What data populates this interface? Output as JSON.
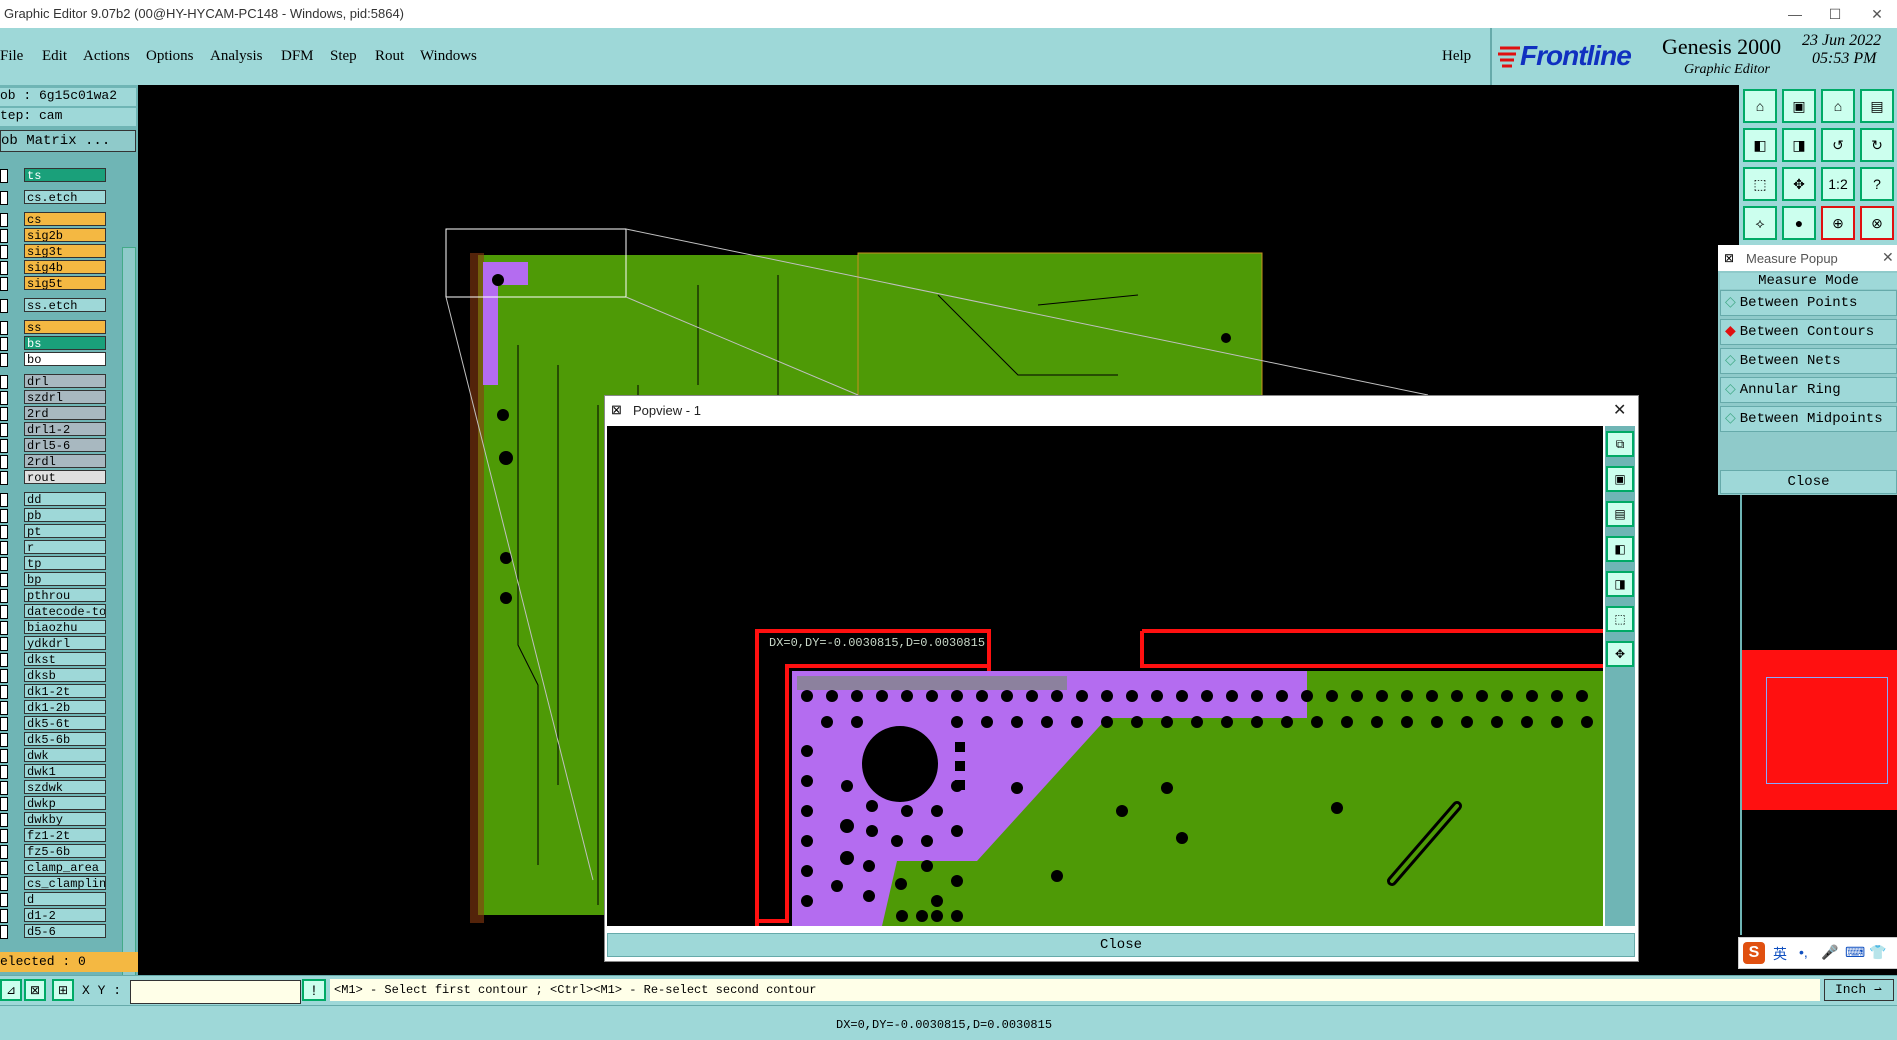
{
  "window": {
    "title": "Graphic Editor 9.07b2 (00@HY-HYCAM-PC148 - Windows, pid:5864)",
    "minimize": "—",
    "maximize": "☐",
    "close": "✕"
  },
  "menu": {
    "items": [
      "File",
      "Edit",
      "Actions",
      "Options",
      "Analysis",
      "DFM",
      "Step",
      "Rout",
      "Windows"
    ],
    "help": "Help"
  },
  "brand": {
    "logo": "Frontline",
    "product": "Genesis 2000",
    "subtitle": "Graphic Editor",
    "date": "23 Jun 2022",
    "time": "05:53 PM"
  },
  "job": {
    "job_line": "ob : 6g15c01wa2",
    "step_line": "tep: cam",
    "matrix_button": "ob Matrix ..."
  },
  "layers": [
    {
      "name": "ts",
      "color": "#1aa07a",
      "text": "#fff"
    },
    {
      "name": "cs.etch",
      "color": "#9ed8d8",
      "text": "#000"
    },
    {
      "name": "cs",
      "color": "#f4b842",
      "text": "#000"
    },
    {
      "name": "sig2b",
      "color": "#f4b842",
      "text": "#000"
    },
    {
      "name": "sig3t",
      "color": "#f4b842",
      "text": "#000"
    },
    {
      "name": "sig4b",
      "color": "#f4b842",
      "text": "#000"
    },
    {
      "name": "sig5t",
      "color": "#f4b842",
      "text": "#000"
    },
    {
      "name": "ss.etch",
      "color": "#9ed8d8",
      "text": "#000"
    },
    {
      "name": "ss",
      "color": "#f4b842",
      "text": "#000"
    },
    {
      "name": "bs",
      "color": "#1aa07a",
      "text": "#fff"
    },
    {
      "name": "bo",
      "color": "#ffffff",
      "text": "#000"
    },
    {
      "name": "drl",
      "color": "#a8b8c0",
      "text": "#000"
    },
    {
      "name": "szdrl",
      "color": "#a8b8c0",
      "text": "#000"
    },
    {
      "name": "2rd",
      "color": "#a8b8c0",
      "text": "#000"
    },
    {
      "name": "drl1-2",
      "color": "#a8b8c0",
      "text": "#000"
    },
    {
      "name": "drl5-6",
      "color": "#a8b8c0",
      "text": "#000"
    },
    {
      "name": "2rdl",
      "color": "#a8b8c0",
      "text": "#000"
    },
    {
      "name": "rout",
      "color": "#e0e0e0",
      "text": "#000"
    },
    {
      "name": "dd",
      "color": "#9ed8d8",
      "text": "#000"
    },
    {
      "name": "pb",
      "color": "#9ed8d8",
      "text": "#000"
    },
    {
      "name": "pt",
      "color": "#9ed8d8",
      "text": "#000"
    },
    {
      "name": "r",
      "color": "#9ed8d8",
      "text": "#000"
    },
    {
      "name": "tp",
      "color": "#9ed8d8",
      "text": "#000"
    },
    {
      "name": "bp",
      "color": "#9ed8d8",
      "text": "#000"
    },
    {
      "name": "pthrou",
      "color": "#9ed8d8",
      "text": "#000"
    },
    {
      "name": "datecode-to",
      "color": "#9ed8d8",
      "text": "#000"
    },
    {
      "name": "biaozhu",
      "color": "#9ed8d8",
      "text": "#000"
    },
    {
      "name": "ydkdrl",
      "color": "#9ed8d8",
      "text": "#000"
    },
    {
      "name": "dkst",
      "color": "#9ed8d8",
      "text": "#000"
    },
    {
      "name": "dksb",
      "color": "#9ed8d8",
      "text": "#000"
    },
    {
      "name": "dk1-2t",
      "color": "#9ed8d8",
      "text": "#000"
    },
    {
      "name": "dk1-2b",
      "color": "#9ed8d8",
      "text": "#000"
    },
    {
      "name": "dk5-6t",
      "color": "#9ed8d8",
      "text": "#000"
    },
    {
      "name": "dk5-6b",
      "color": "#9ed8d8",
      "text": "#000"
    },
    {
      "name": "dwk",
      "color": "#9ed8d8",
      "text": "#000"
    },
    {
      "name": "dwk1",
      "color": "#9ed8d8",
      "text": "#000"
    },
    {
      "name": "szdwk",
      "color": "#9ed8d8",
      "text": "#000"
    },
    {
      "name": "dwkp",
      "color": "#9ed8d8",
      "text": "#000"
    },
    {
      "name": "dwkby",
      "color": "#9ed8d8",
      "text": "#000"
    },
    {
      "name": "fz1-2t",
      "color": "#9ed8d8",
      "text": "#000"
    },
    {
      "name": "fz5-6b",
      "color": "#9ed8d8",
      "text": "#000"
    },
    {
      "name": "clamp_area",
      "color": "#9ed8d8",
      "text": "#000"
    },
    {
      "name": "cs_clampline",
      "color": "#9ed8d8",
      "text": "#000"
    },
    {
      "name": "d",
      "color": "#9ed8d8",
      "text": "#000"
    },
    {
      "name": "d1-2",
      "color": "#9ed8d8",
      "text": "#000"
    },
    {
      "name": "d5-6",
      "color": "#9ed8d8",
      "text": "#000"
    }
  ],
  "selected": "elected : 0",
  "measure": {
    "title": "Measure Popup",
    "mode_label": "Measure Mode",
    "options": [
      "Between Points",
      "Between Contours",
      "Between Nets",
      "Annular Ring",
      "Between Midpoints"
    ],
    "selected_option": "Between Contours",
    "close": "Close"
  },
  "popview": {
    "title": "Popview - 1",
    "measure_label": "DX=0,DY=-0.0030815,D=0.0030815",
    "close": "Close"
  },
  "command": {
    "xy_label": "X Y :",
    "xy_value": "",
    "prompt": "<M1> - Select first contour ; <Ctrl><M1> - Re-select second contour",
    "units": "Inch"
  },
  "status": {
    "text": "DX=0,DY=-0.0030815,D=0.0030815"
  },
  "ime": {
    "lang": "英"
  },
  "colors": {
    "board_green": "#4e9a06",
    "selected_purple": "#b46cf0",
    "outline_red": "#ff1010",
    "panel_teal": "#9ed8d8"
  }
}
